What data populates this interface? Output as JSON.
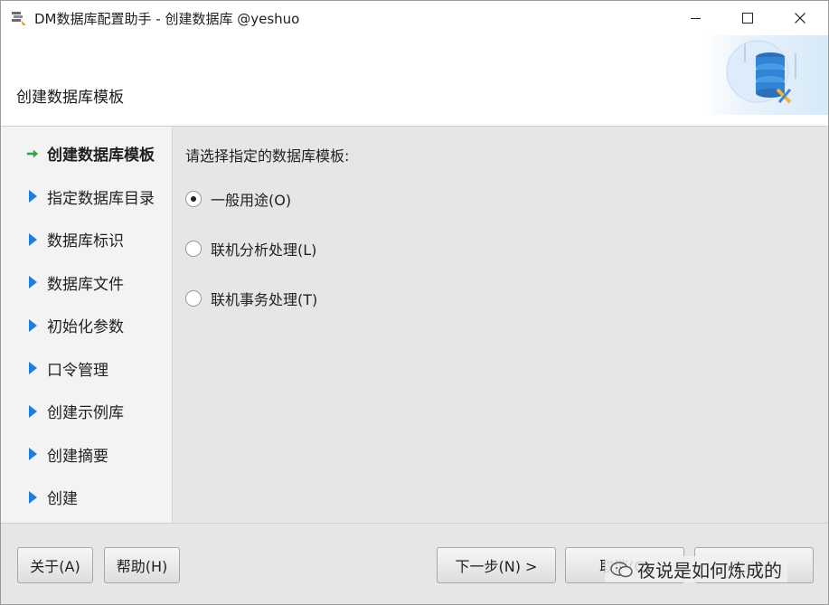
{
  "window": {
    "title": "DM数据库配置助手 - 创建数据库 @yeshuo",
    "minimize_icon": "minimize-icon",
    "maximize_icon": "maximize-icon",
    "close_icon": "close-icon"
  },
  "header": {
    "title": "创建数据库模板",
    "art_icon": "database-tools-icon"
  },
  "nav": {
    "items": [
      {
        "label": "创建数据库模板",
        "active": true,
        "icon": "green-arrow-icon"
      },
      {
        "label": "指定数据库目录",
        "active": false,
        "icon": "blue-triangle-icon"
      },
      {
        "label": "数据库标识",
        "active": false,
        "icon": "blue-triangle-icon"
      },
      {
        "label": "数据库文件",
        "active": false,
        "icon": "blue-triangle-icon"
      },
      {
        "label": "初始化参数",
        "active": false,
        "icon": "blue-triangle-icon"
      },
      {
        "label": "口令管理",
        "active": false,
        "icon": "blue-triangle-icon"
      },
      {
        "label": "创建示例库",
        "active": false,
        "icon": "blue-triangle-icon"
      },
      {
        "label": "创建摘要",
        "active": false,
        "icon": "blue-triangle-icon"
      },
      {
        "label": "创建",
        "active": false,
        "icon": "blue-triangle-icon"
      }
    ]
  },
  "content": {
    "prompt": "请选择指定的数据库模板:",
    "options": [
      {
        "label": "一般用途(O)",
        "selected": true
      },
      {
        "label": "联机分析处理(L)",
        "selected": false
      },
      {
        "label": "联机事务处理(T)",
        "selected": false
      }
    ]
  },
  "footer": {
    "about_label": "关于(A)",
    "help_label": "帮助(H)",
    "next_label": "下一步(N) >",
    "cancel_label": "取消(C)",
    "finish_label": "完成(F)",
    "watermark_text": "夜说是如何炼成的"
  },
  "colors": {
    "accent_arrow": "#2fa84f",
    "nav_triangle": "#1f7fd8"
  }
}
